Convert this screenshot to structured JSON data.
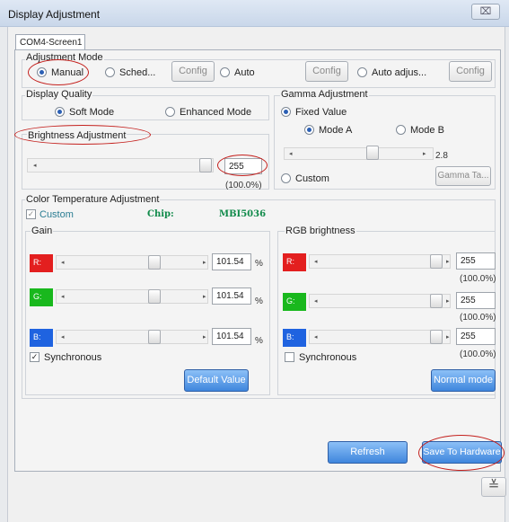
{
  "window": {
    "title": "Display Adjustment",
    "close_symbol": "⌧"
  },
  "tab": {
    "label": "COM4-Screen1"
  },
  "adjustment_mode": {
    "label": "Adjustment Mode",
    "manual": "Manual",
    "schedule": "Sched...",
    "config1": "Config",
    "auto": "Auto",
    "config2": "Config",
    "auto_adjust": "Auto adjus...",
    "config3": "Config"
  },
  "display_quality": {
    "label": "Display Quality",
    "soft": "Soft Mode",
    "enhanced": "Enhanced Mode"
  },
  "brightness": {
    "label": "Brightness Adjustment",
    "value": "255",
    "percent": "(100.0%)"
  },
  "gamma": {
    "label": "Gamma Adjustment",
    "fixed": "Fixed Value",
    "mode_a": "Mode A",
    "mode_b": "Mode B",
    "value": "2.8",
    "custom": "Custom",
    "table_btn": "Gamma Ta..."
  },
  "color_temp": {
    "label": "Color Temperature Adjustment",
    "custom": "Custom",
    "chip_label": "Chip:",
    "chip_value": "MBI5036"
  },
  "gain": {
    "label": "Gain",
    "rows": [
      {
        "ch": "R:",
        "value": "101.54",
        "unit": "%",
        "color": "#e31f1f"
      },
      {
        "ch": "G:",
        "value": "101.54",
        "unit": "%",
        "color": "#19b81d"
      },
      {
        "ch": "B:",
        "value": "101.54",
        "unit": "%",
        "color": "#1f63e0"
      }
    ],
    "sync": "Synchronous",
    "default_btn": "Default Value"
  },
  "rgb": {
    "label": "RGB brightness",
    "rows": [
      {
        "ch": "R:",
        "value": "255",
        "percent": "(100.0%)",
        "color": "#e31f1f"
      },
      {
        "ch": "G:",
        "value": "255",
        "percent": "(100.0%)",
        "color": "#19b81d"
      },
      {
        "ch": "B:",
        "value": "255",
        "percent": "(100.0%)",
        "color": "#1f63e0"
      }
    ],
    "sync": "Synchronous",
    "normal_btn": "Normal mode"
  },
  "footer": {
    "refresh": "Refresh",
    "save": "Save To Hardware",
    "expand_symbol": "≚"
  },
  "theme": {
    "accent": "#3f86dd",
    "highlight_ring": "#c4201d"
  }
}
